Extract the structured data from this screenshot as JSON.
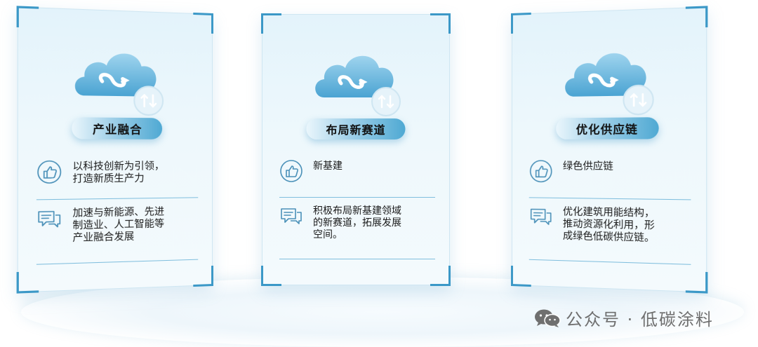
{
  "cards": [
    {
      "title": "产业融合",
      "row1_text": "以科技创新为引领，\n打造新质生产力",
      "row2_text": "加速与新能源、先进\n制造业、人工智能等\n产业融合发展",
      "row1_icon": "thumbs-up-icon",
      "row2_icon": "chat-bubbles-icon"
    },
    {
      "title": "布局新赛道",
      "row1_text": "新基建",
      "row2_text": "积极布局新基建领域\n的新赛道，拓展发展\n空间。",
      "row1_icon": "thumbs-up-icon",
      "row2_icon": "chat-bubbles-icon"
    },
    {
      "title": "优化供应链",
      "row1_text": "绿色供应链",
      "row2_text": "优化建筑用能结构，\n推动资源化利用，形\n成绿色低碳供应链。",
      "row1_icon": "thumbs-up-icon",
      "row2_icon": "chat-bubbles-icon"
    }
  ],
  "watermark": {
    "text": "公众号 · 低碳涂料",
    "icon": "wechat-icon"
  },
  "colors": {
    "accent": "#3b98c7",
    "icon_stroke": "#4a90b8",
    "cloud_light": "#bfe2f2",
    "cloud_dark": "#5fb0d8"
  }
}
